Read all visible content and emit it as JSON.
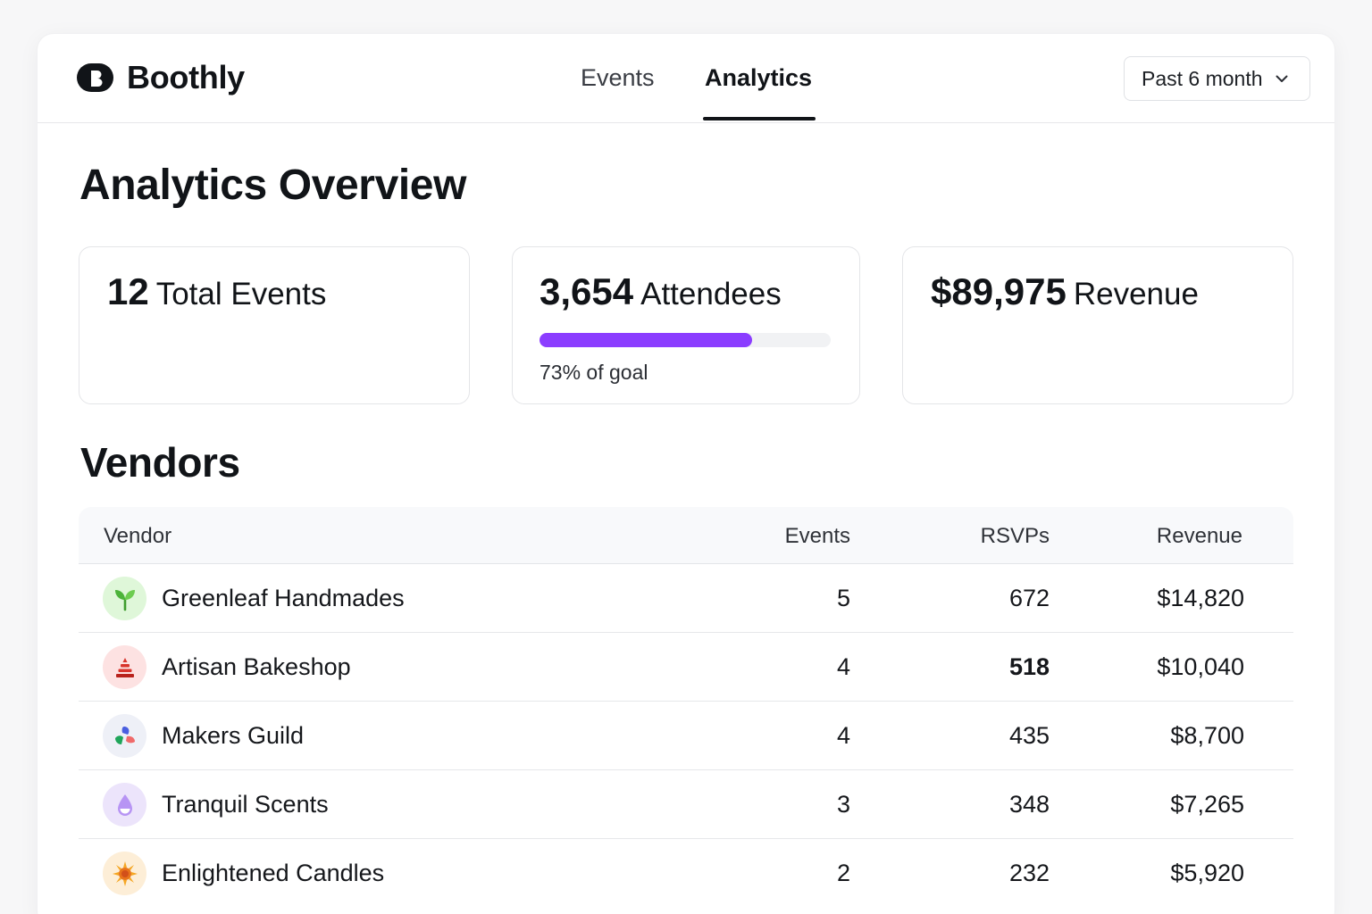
{
  "brand": {
    "name": "Boothly"
  },
  "nav": {
    "tabs": [
      {
        "label": "Events"
      },
      {
        "label": "Analytics",
        "active": true
      }
    ]
  },
  "range": {
    "label": "Past 6 month"
  },
  "page_title": "Analytics Overview",
  "stats": [
    {
      "value": "12",
      "label": "Total Events"
    },
    {
      "value": "3,654",
      "label": "Attendees",
      "progress": 0.73,
      "progress_text": "73% of goal"
    },
    {
      "value": "$89,975",
      "label": "Revenue"
    }
  ],
  "vendors": {
    "title": "Vendors",
    "columns": [
      "Vendor",
      "Events",
      "RSVPs",
      "Revenue"
    ],
    "rows": [
      {
        "name": "Greenleaf Handmades",
        "events": "5",
        "rsvps": "672",
        "revenue": "$14,820",
        "icon": "sprout-icon"
      },
      {
        "name": "Artisan Bakeshop",
        "events": "4",
        "rsvps": "518",
        "revenue": "$10,040",
        "icon": "cake-icon"
      },
      {
        "name": "Makers Guild",
        "events": "4",
        "rsvps": "435",
        "revenue": "$8,700",
        "icon": "petals-icon"
      },
      {
        "name": "Tranquil Scents",
        "events": "3",
        "rsvps": "348",
        "revenue": "$7,265",
        "icon": "droplet-icon"
      },
      {
        "name": "Enlightened Candles",
        "events": "2",
        "rsvps": "232",
        "revenue": "$5,920",
        "icon": "sun-icon"
      }
    ]
  },
  "colors": {
    "accent": "#8b3dff",
    "text": "#111418",
    "border": "#e4e5e8"
  }
}
